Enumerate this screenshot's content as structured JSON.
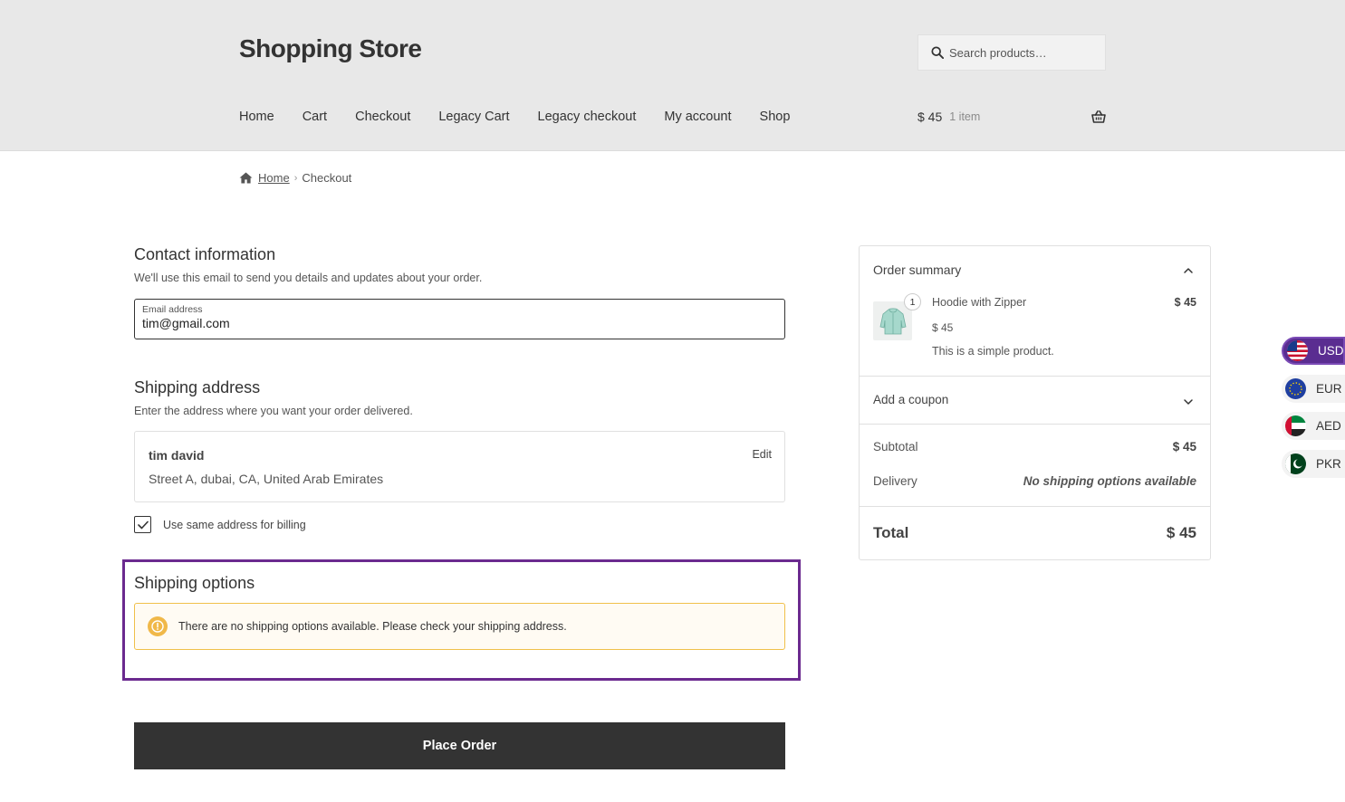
{
  "header": {
    "site_title": "Shopping Store",
    "search_placeholder": "Search products…",
    "nav": [
      "Home",
      "Cart",
      "Checkout",
      "Legacy Cart",
      "Legacy checkout",
      "My account",
      "Shop"
    ],
    "cart_total": "$ 45",
    "cart_count": "1 item"
  },
  "breadcrumb": {
    "home": "Home",
    "current": "Checkout"
  },
  "contact": {
    "title": "Contact information",
    "description": "We'll use this email to send you details and updates about your order.",
    "email_label": "Email address",
    "email_value": "tim@gmail.com"
  },
  "shipping_address": {
    "title": "Shipping address",
    "description": "Enter the address where you want your order delivered.",
    "name": "tim david",
    "address": "Street A, dubai, CA, United Arab Emirates",
    "edit_label": "Edit",
    "billing_checkbox_label": "Use same address for billing",
    "billing_checked": true
  },
  "shipping_options": {
    "title": "Shipping options",
    "notice": "There are no shipping options available. Please check your shipping address."
  },
  "place_order_label": "Place Order",
  "order_summary": {
    "title": "Order summary",
    "item": {
      "quantity": "1",
      "name": "Hoodie with Zipper",
      "line_total": "$ 45",
      "price": "$ 45",
      "description": "This is a simple product."
    },
    "coupon_label": "Add a coupon",
    "subtotal_label": "Subtotal",
    "subtotal_value": "$ 45",
    "delivery_label": "Delivery",
    "delivery_value": "No shipping options available",
    "total_label": "Total",
    "total_value": "$ 45"
  },
  "currencies": [
    {
      "code": "USD",
      "active": true
    },
    {
      "code": "EUR",
      "active": false
    },
    {
      "code": "AED",
      "active": false
    },
    {
      "code": "PKR",
      "active": false
    }
  ],
  "colors": {
    "header_bg": "#e8e8e8",
    "accent_purple": "#6b2a8f",
    "warning": "#f0b849",
    "button_bg": "#333333"
  }
}
